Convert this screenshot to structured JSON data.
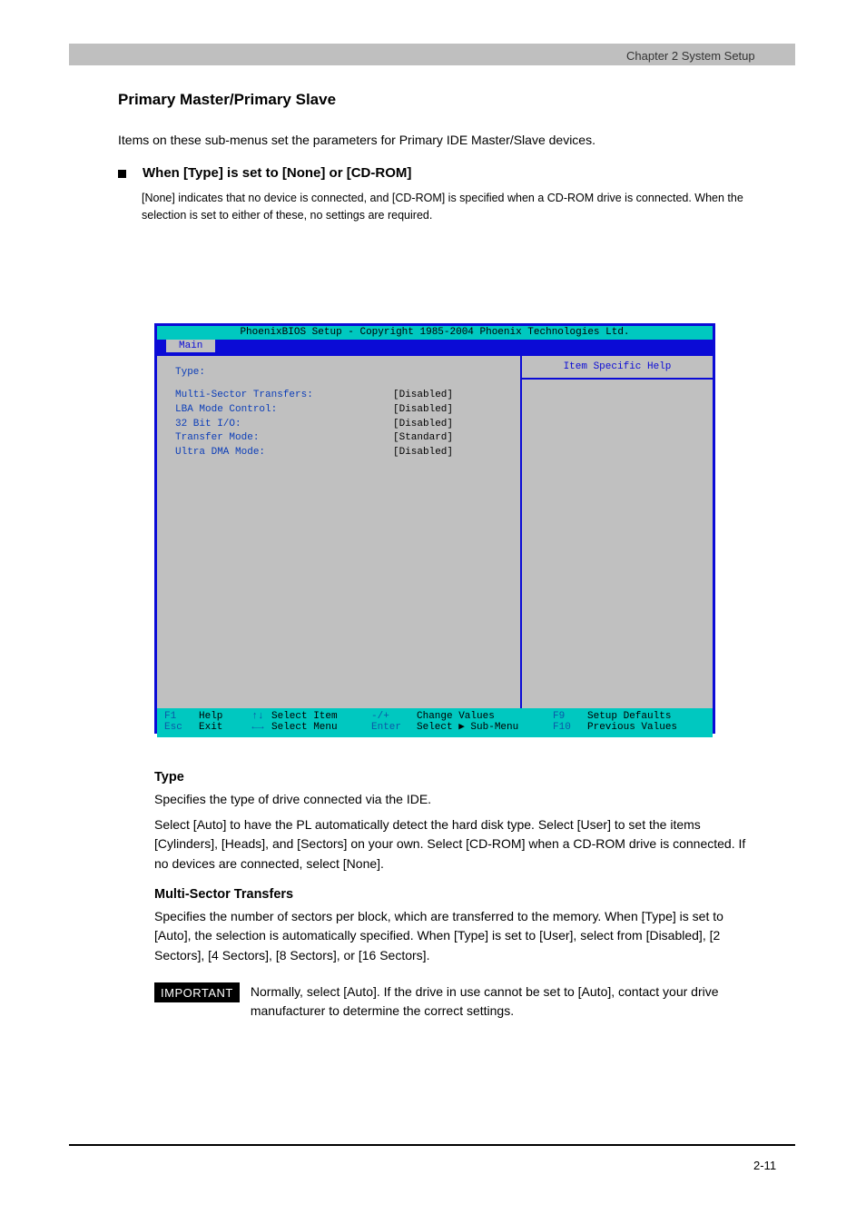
{
  "header": {
    "text": "Chapter 2 System Setup"
  },
  "section": {
    "title": "Primary Master/Primary Slave",
    "intro": "Items on these sub-menus set the parameters for Primary IDE Master/Slave devices."
  },
  "bullet": {
    "subhead": "When [Type] is set to [None] or [CD-ROM]",
    "note": "[None] indicates that no device is connected, and [CD-ROM] is specified when a CD-ROM drive is connected. When the selection is set to either of these, no settings are required."
  },
  "bios": {
    "title": "PhoenixBIOS Setup - Copyright 1985-2004 Phoenix Technologies Ltd.",
    "tab": "Main",
    "help_title": "Item Specific Help",
    "rows": [
      {
        "label": "Type:",
        "value": ""
      },
      {
        "label": "Multi-Sector Transfers:",
        "value": "[Disabled]"
      },
      {
        "label": "LBA Mode Control:",
        "value": "[Disabled]"
      },
      {
        "label": "32 Bit I/O:",
        "value": "[Disabled]"
      },
      {
        "label": "Transfer Mode:",
        "value": "[Standard]"
      },
      {
        "label": "Ultra DMA Mode:",
        "value": "[Disabled]"
      }
    ],
    "footer": {
      "r1": {
        "k1": "F1",
        "t1": "Help",
        "s1": "↑↓",
        "t2": "Select Item",
        "k2": "-/+",
        "t3": "Change Values",
        "k3": "F9",
        "t4": "Setup Defaults"
      },
      "r2": {
        "k1": "Esc",
        "t1": "Exit",
        "s1": "←→",
        "t2": "Select Menu",
        "k2": "Enter",
        "t3": "Select ▶ Sub-Menu",
        "k3": "F10",
        "t4": "Previous Values"
      }
    }
  },
  "items": {
    "type": {
      "title": "Type",
      "body1": "Specifies the type of drive connected via the IDE.",
      "body2": "Select [Auto] to have the PL automatically detect the hard disk type. Select [User] to set the items [Cylinders], [Heads], and [Sectors] on your own. Select [CD-ROM] when a CD-ROM drive is connected. If no devices are connected, select [None]."
    },
    "multi": {
      "title": "Multi-Sector Transfers",
      "body": "Specifies the number of sectors per block, which are transferred to the memory. When [Type] is set to [Auto], the selection is automatically specified. When [Type] is set to [User], select from [Disabled], [2 Sectors], [4 Sectors], [8 Sectors], or [16 Sectors]."
    }
  },
  "important": {
    "label": "IMPORTANT",
    "text": "Normally, select [Auto]. If the drive in use cannot be set to [Auto], contact your drive manufacturer to determine the correct settings."
  },
  "page_number": "2-11"
}
